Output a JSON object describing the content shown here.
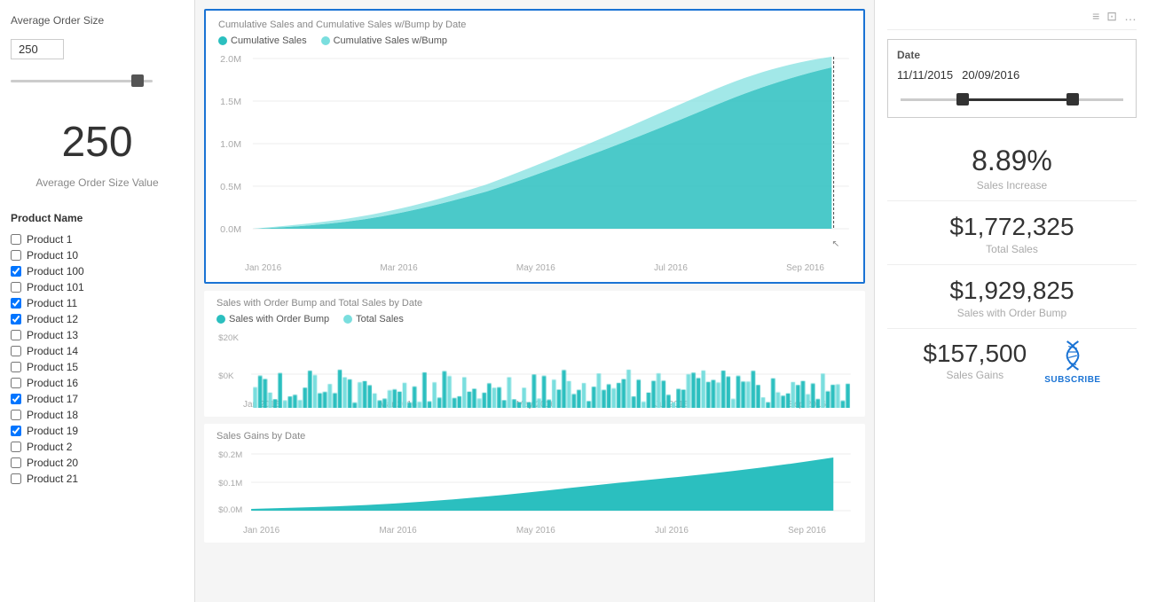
{
  "left_panel": {
    "slider_label": "Average Order Size",
    "slider_value": "250",
    "big_value": "250",
    "big_label": "Average Order Size Value",
    "product_list_title": "Product Name",
    "products": [
      {
        "name": "Product 1",
        "checked": false
      },
      {
        "name": "Product 10",
        "checked": false
      },
      {
        "name": "Product 100",
        "checked": true
      },
      {
        "name": "Product 101",
        "checked": false
      },
      {
        "name": "Product 11",
        "checked": true
      },
      {
        "name": "Product 12",
        "checked": true
      },
      {
        "name": "Product 13",
        "checked": false
      },
      {
        "name": "Product 14",
        "checked": false
      },
      {
        "name": "Product 15",
        "checked": false
      },
      {
        "name": "Product 16",
        "checked": false
      },
      {
        "name": "Product 17",
        "checked": true
      },
      {
        "name": "Product 18",
        "checked": false
      },
      {
        "name": "Product 19",
        "checked": true
      },
      {
        "name": "Product 2",
        "checked": false
      },
      {
        "name": "Product 20",
        "checked": false
      },
      {
        "name": "Product 21",
        "checked": false
      }
    ]
  },
  "main_chart": {
    "title": "Cumulative Sales and Cumulative Sales w/Bump by Date",
    "legend": [
      {
        "label": "Cumulative Sales",
        "color": "#2bbfbf"
      },
      {
        "label": "Cumulative Sales w/Bump",
        "color": "#7adede"
      }
    ],
    "y_labels": [
      "2.0M",
      "1.5M",
      "1.0M",
      "0.5M",
      "0.0M"
    ],
    "x_labels": [
      "Jan 2016",
      "Mar 2016",
      "May 2016",
      "Jul 2016",
      "Sep 2016"
    ]
  },
  "sales_bump_chart": {
    "title": "Sales with Order Bump and Total Sales by Date",
    "legend": [
      {
        "label": "Sales with Order Bump",
        "color": "#2bbfbf"
      },
      {
        "label": "Total Sales",
        "color": "#7adede"
      }
    ],
    "y_labels": [
      "$20K",
      "$0K"
    ],
    "x_labels": [
      "Jan 2016",
      "Mar 2016",
      "May 2016",
      "Jul 2016",
      "Sep 2016"
    ]
  },
  "gains_chart": {
    "title": "Sales Gains by Date",
    "y_labels": [
      "$0.2M",
      "$0.1M",
      "$0.0M"
    ],
    "x_labels": [
      "Jan 2016",
      "Mar 2016",
      "May 2016",
      "Jul 2016",
      "Sep 2016"
    ]
  },
  "right_panel": {
    "icons": [
      "≡",
      "⊡",
      "…"
    ],
    "date_filter": {
      "label": "Date",
      "start_date": "11/11/2015",
      "end_date": "20/09/2016"
    },
    "stats": [
      {
        "value": "8.89%",
        "label": "Sales Increase",
        "type": "pct"
      },
      {
        "value": "$1,772,325",
        "label": "Total Sales"
      },
      {
        "value": "$1,929,825",
        "label": "Sales with Order Bump"
      },
      {
        "value": "$157,500",
        "label": "Sales Gains"
      }
    ],
    "subscribe_text": "SUBSCRIBE"
  }
}
